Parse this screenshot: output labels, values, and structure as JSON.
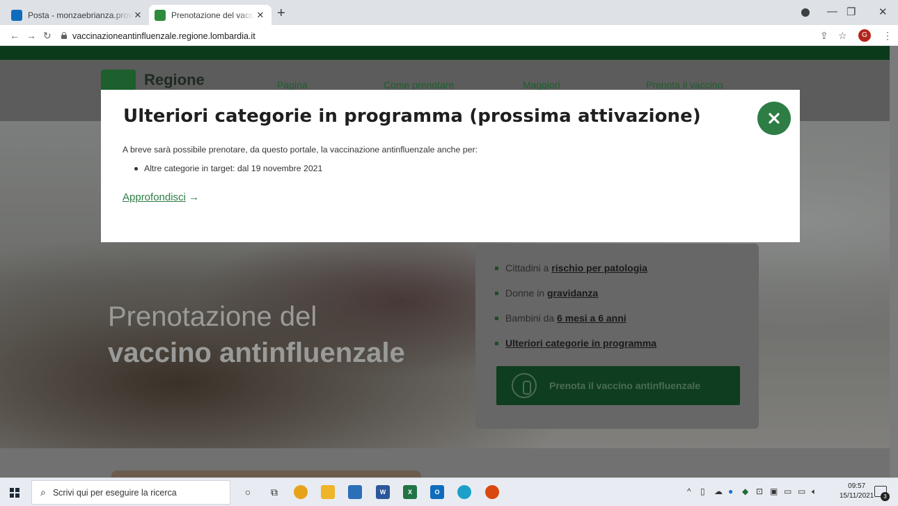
{
  "browser": {
    "tabs": [
      {
        "title": "Posta - monzaebrianza.provincia",
        "favicon": "outlook-icon",
        "color": "#0f6cbd"
      },
      {
        "title": "Prenotazione del vaccino antinfl",
        "favicon": "regione-lombardia-icon",
        "color": "#2e8b3d"
      }
    ],
    "new_tab": "+",
    "url": "vaccinazioneantinfluenzale.regione.lombardia.it",
    "avatar_letter": "G"
  },
  "site": {
    "logo_text": "Regione",
    "nav": [
      "Pagina",
      "Come prenotare",
      "Maggiori",
      "Prenota il vaccino"
    ],
    "hero_title_line1": "Prenotazione del",
    "hero_title_line2": "vaccino antinfluenzale",
    "card_items": [
      {
        "prefix": "Cittadini a",
        "link": "rischio per patologia"
      },
      {
        "prefix": "Donne in",
        "link": "gravidanza"
      },
      {
        "prefix": "Bambini da",
        "link": "6 mesi a 6 anni"
      },
      {
        "prefix": "",
        "link": "Ulteriori categorie in programma"
      }
    ],
    "card_button": "Prenota il vaccino antinfluenzale"
  },
  "modal": {
    "title": "Ulteriori categorie in programma (prossima attivazione)",
    "intro": "A breve sarà possibile prenotare, da questo portale, la vaccinazione antinfluenzale anche per:",
    "bullets": [
      "Altre categorie in target: dal 19 novembre 2021"
    ],
    "link_label": "Approfondisci",
    "link_arrow": "→",
    "accent": "#2e7d45"
  },
  "taskbar": {
    "search_placeholder": "Scrivi qui per eseguire la ricerca",
    "time": "09:57",
    "date": "15/11/2021",
    "notification_count": "3"
  }
}
